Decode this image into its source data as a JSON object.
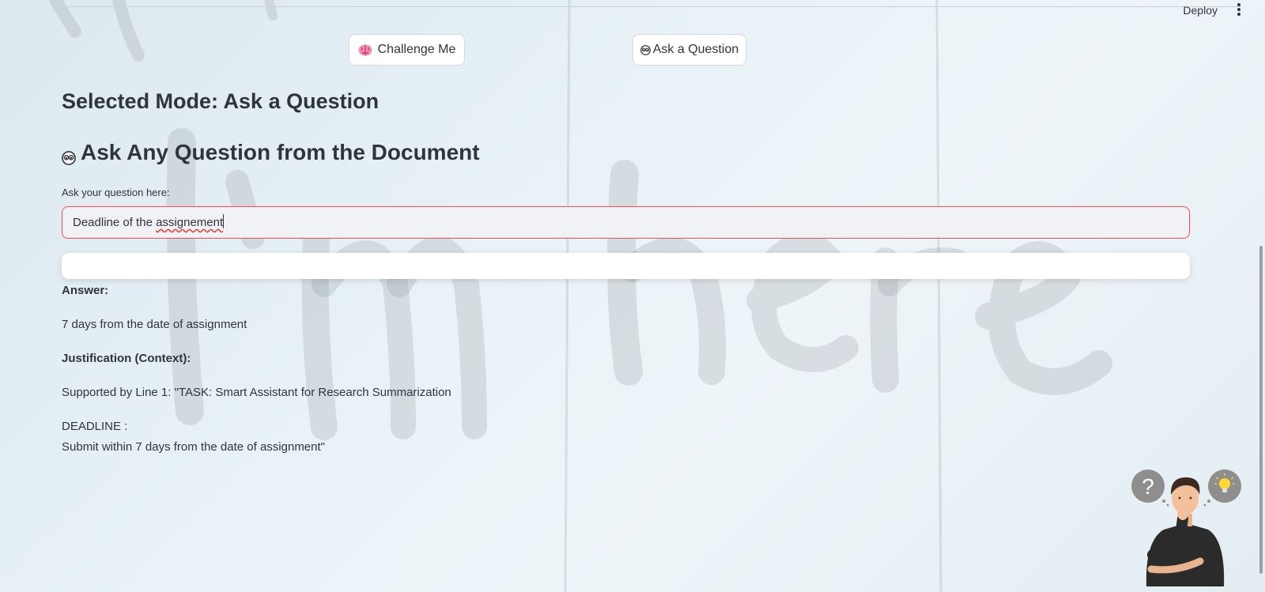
{
  "header": {
    "deploy_label": "Deploy"
  },
  "mode_buttons": {
    "challenge_label": "Challenge Me",
    "ask_label": "Ask a Question"
  },
  "main": {
    "selected_mode": "Selected Mode: Ask a Question",
    "section_title": "Ask Any Question from the Document",
    "question_label": "Ask your question here:",
    "question_value_prefix": "Deadline of the ",
    "question_value_misspelled": "assignement",
    "answer_heading": "Answer:",
    "answer_text": "7 days from the date of assignment",
    "justification_heading": "Justification (Context):",
    "justification_line1": "Supported by Line 1: \"TASK: Smart Assistant for Research Summarization",
    "justification_line2": "DEADLINE :",
    "justification_line3": "Submit within 7 days from the date of assignment\""
  },
  "background": {
    "watermark_text": "I'm here"
  },
  "icons": {
    "brain": "brain-icon",
    "eyes": "eyes-icon",
    "kebab": "kebab-menu-icon"
  },
  "colors": {
    "accent": "#ff4b4b",
    "text": "#31333f",
    "input_bg": "#f0f2f6"
  }
}
